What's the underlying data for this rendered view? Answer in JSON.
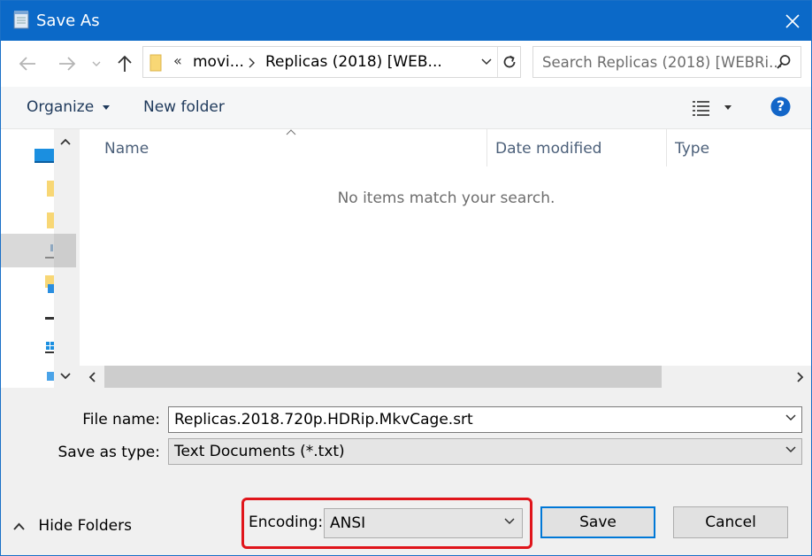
{
  "window": {
    "title": "Save As",
    "title_icon": "notepad-icon",
    "close_icon": "close-icon"
  },
  "nav": {
    "back_icon": "arrow-left-icon",
    "forward_icon": "arrow-right-icon",
    "recent_icon": "chevron-down-icon",
    "up_icon": "arrow-up-icon",
    "breadcrumb_overflow": "«",
    "breadcrumb": [
      "movi...",
      "Replicas (2018) [WEB..."
    ],
    "search_placeholder": "Search Replicas (2018) [WEBRi...",
    "search_icon": "search-icon",
    "refresh_icon": "refresh-icon"
  },
  "toolbar": {
    "organize_label": "Organize",
    "new_folder_label": "New folder",
    "view_icon": "details-view-icon",
    "help_icon": "help-icon",
    "help_glyph": "?"
  },
  "file_list": {
    "columns": [
      "Name",
      "Date modified",
      "Type"
    ],
    "empty_message": "No items match your search."
  },
  "form": {
    "file_name_label": "File name:",
    "file_name_value": "Replicas.2018.720p.HDRip.MkvCage.srt",
    "save_type_label": "Save as type:",
    "save_type_value": "Text Documents (*.txt)",
    "hide_folders_label": "Hide Folders",
    "encoding_label": "Encoding:",
    "encoding_value": "ANSI",
    "save_label": "Save",
    "cancel_label": "Cancel"
  },
  "colors": {
    "titlebar": "#0b69c8",
    "highlight": "#e0151b",
    "primary_border": "#0078d7"
  }
}
